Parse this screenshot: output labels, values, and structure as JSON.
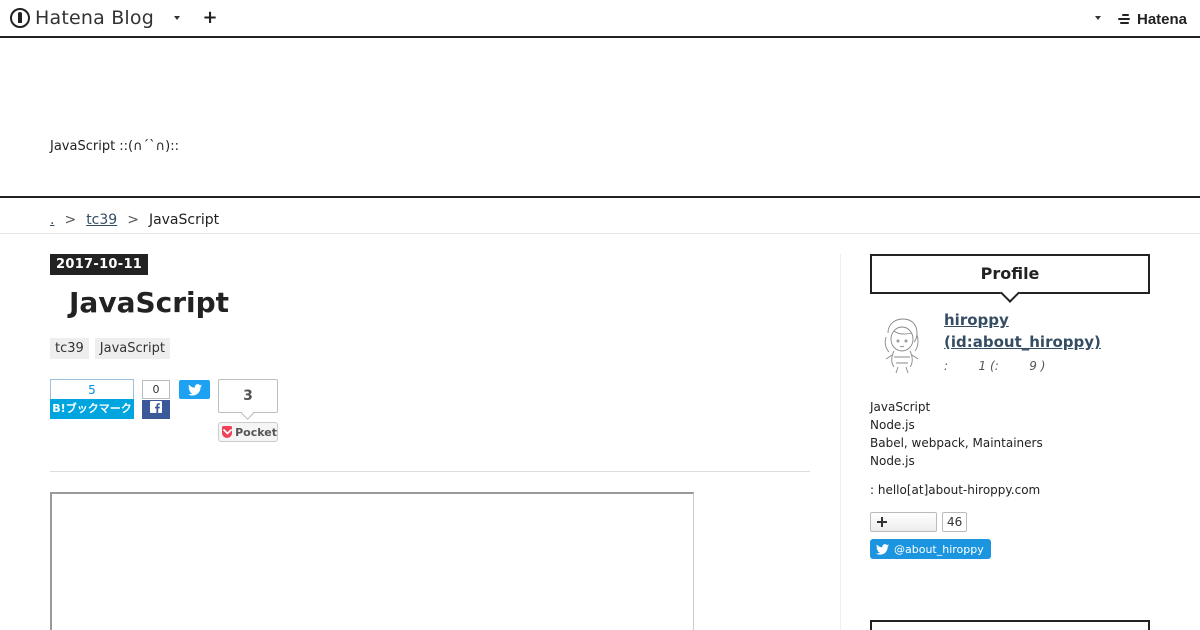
{
  "global_header": {
    "logo_text": "Hatena Blog",
    "plus_label": "+",
    "hatena_text": "Hatena"
  },
  "blog": {
    "title": "JavaScript ::(∩´`∩)::"
  },
  "breadcrumb": {
    "home": ".",
    "separator": ">",
    "category": "tc39",
    "current": "JavaScript"
  },
  "entry": {
    "date": "2017-10-11",
    "title": "JavaScript",
    "categories": [
      "tc39",
      "JavaScript"
    ]
  },
  "share": {
    "hatena_count": "5",
    "hatena_label": "B!ブックマーク",
    "facebook_count": "0",
    "pocket_count": "3",
    "pocket_label": "Pocket"
  },
  "sidebar": {
    "profile_heading": "Profile",
    "profile_name_line1": "hiroppy",
    "profile_name_line2": "(id:about_hiroppy)",
    "profile_meta": ":        1 (:        9 )",
    "description_lines": [
      "JavaScript",
      "Node.js",
      "Babel, webpack, Maintainers",
      "Node.js"
    ],
    "contact": ": hello[at]about-hiroppy.com",
    "follower_count": "46",
    "twitter_follow": "@about_hiroppy"
  },
  "colors": {
    "accent": "#222222",
    "link": "#354d63",
    "hatena_blue": "#00a4de",
    "facebook_blue": "#3b5998",
    "twitter_blue": "#1da1f2",
    "pocket_red": "#ef4056"
  }
}
